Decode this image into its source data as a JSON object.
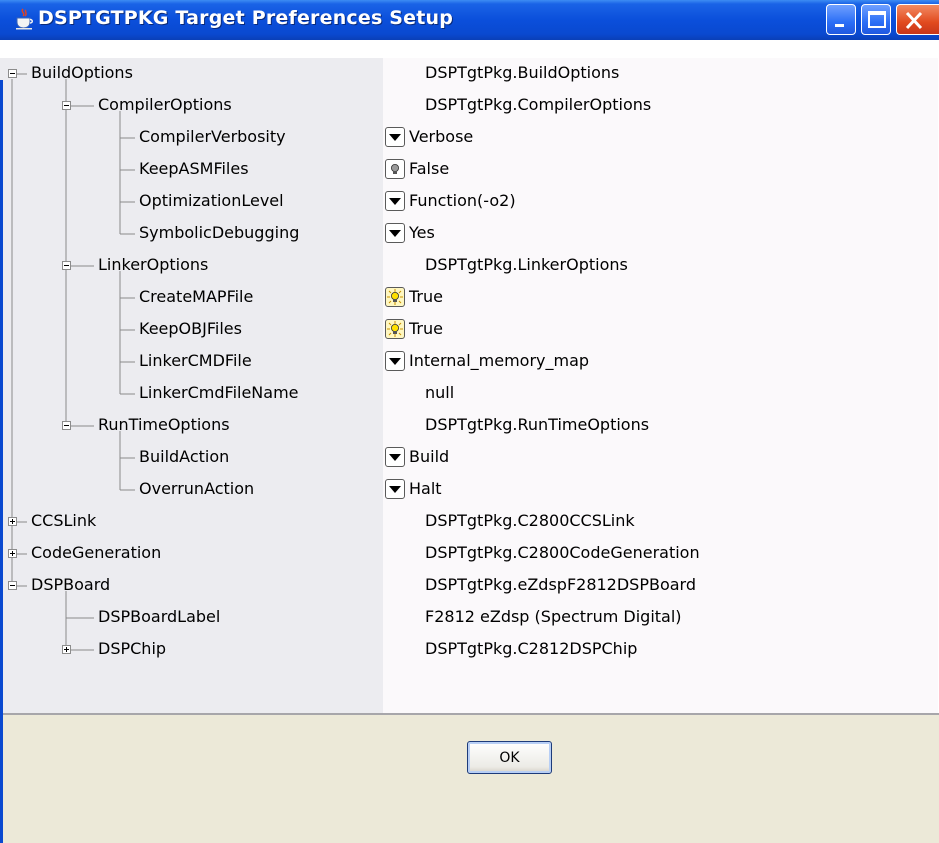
{
  "window": {
    "title": "DSPTGTPKG Target Preferences Setup",
    "icon": "java-cup-icon",
    "controls": [
      "minimize-icon",
      "maximize-icon",
      "close-icon"
    ]
  },
  "tree": {
    "rows": [
      {
        "name": "BuildOptions",
        "value": "DSPTgtPkg.BuildOptions",
        "depth": 0,
        "expander": "collapse",
        "editor": "none"
      },
      {
        "name": "CompilerOptions",
        "value": "DSPTgtPkg.CompilerOptions",
        "depth": 1,
        "expander": "collapse",
        "editor": "none"
      },
      {
        "name": "CompilerVerbosity",
        "value": "Verbose",
        "depth": 2,
        "expander": "none",
        "editor": "dropdown"
      },
      {
        "name": "KeepASMFiles",
        "value": "False",
        "depth": 2,
        "expander": "none",
        "editor": "bulb-off"
      },
      {
        "name": "OptimizationLevel",
        "value": "Function(-o2)",
        "depth": 2,
        "expander": "none",
        "editor": "dropdown"
      },
      {
        "name": "SymbolicDebugging",
        "value": "Yes",
        "depth": 2,
        "expander": "none",
        "editor": "dropdown"
      },
      {
        "name": "LinkerOptions",
        "value": "DSPTgtPkg.LinkerOptions",
        "depth": 1,
        "expander": "collapse",
        "editor": "none"
      },
      {
        "name": "CreateMAPFile",
        "value": "True",
        "depth": 2,
        "expander": "none",
        "editor": "bulb-on"
      },
      {
        "name": "KeepOBJFiles",
        "value": "True",
        "depth": 2,
        "expander": "none",
        "editor": "bulb-on"
      },
      {
        "name": "LinkerCMDFile",
        "value": "Internal_memory_map",
        "depth": 2,
        "expander": "none",
        "editor": "dropdown"
      },
      {
        "name": "LinkerCmdFileName",
        "value": "null",
        "depth": 2,
        "expander": "none",
        "editor": "none"
      },
      {
        "name": "RunTimeOptions",
        "value": "DSPTgtPkg.RunTimeOptions",
        "depth": 1,
        "expander": "collapse",
        "editor": "none"
      },
      {
        "name": "BuildAction",
        "value": "Build",
        "depth": 2,
        "expander": "none",
        "editor": "dropdown"
      },
      {
        "name": "OverrunAction",
        "value": "Halt",
        "depth": 2,
        "expander": "none",
        "editor": "dropdown"
      },
      {
        "name": "CCSLink",
        "value": "DSPTgtPkg.C2800CCSLink",
        "depth": 0,
        "expander": "expand",
        "editor": "none"
      },
      {
        "name": "CodeGeneration",
        "value": "DSPTgtPkg.C2800CodeGeneration",
        "depth": 0,
        "expander": "expand",
        "editor": "none"
      },
      {
        "name": "DSPBoard",
        "value": "DSPTgtPkg.eZdspF2812DSPBoard",
        "depth": 0,
        "expander": "collapse",
        "editor": "none"
      },
      {
        "name": "DSPBoardLabel",
        "value": "F2812 eZdsp (Spectrum Digital)",
        "depth": 1,
        "expander": "none",
        "editor": "none"
      },
      {
        "name": "DSPChip",
        "value": "DSPTgtPkg.C2812DSPChip",
        "depth": 1,
        "expander": "expand",
        "editor": "none"
      }
    ]
  },
  "footer": {
    "ok_label": "OK"
  }
}
